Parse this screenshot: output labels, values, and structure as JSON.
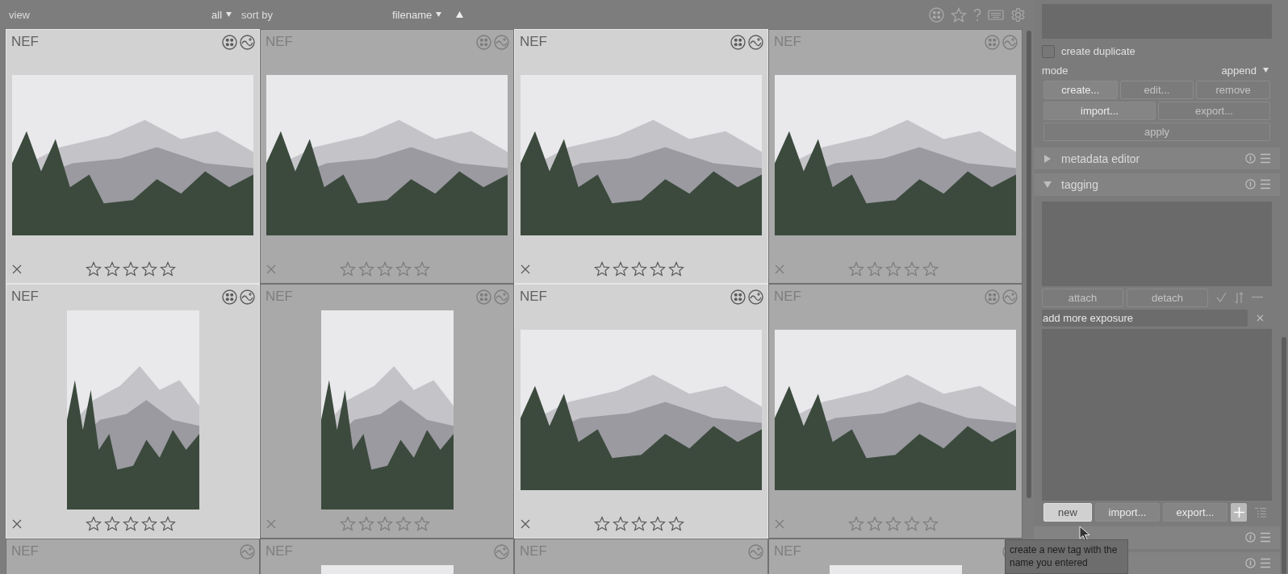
{
  "toolbar": {
    "view_label": "view",
    "view_value": "all",
    "sort_label": "sort by",
    "sort_value": "filename",
    "sort_ascending": true
  },
  "thumbnails": [
    {
      "format": "NEF",
      "selected": true,
      "grouped": true,
      "kind": "landscape",
      "stars": 0
    },
    {
      "format": "NEF",
      "selected": false,
      "grouped": true,
      "kind": "landscape",
      "stars": 0
    },
    {
      "format": "NEF",
      "selected": true,
      "grouped": true,
      "kind": "landscape",
      "stars": 0
    },
    {
      "format": "NEF",
      "selected": false,
      "grouped": true,
      "kind": "landscape",
      "stars": 0
    },
    {
      "format": "NEF",
      "selected": true,
      "grouped": true,
      "kind": "portrait",
      "stars": 0
    },
    {
      "format": "NEF",
      "selected": false,
      "grouped": true,
      "kind": "portrait",
      "stars": 0
    },
    {
      "format": "NEF",
      "selected": true,
      "grouped": true,
      "kind": "landscape",
      "stars": 0
    },
    {
      "format": "NEF",
      "selected": false,
      "grouped": true,
      "kind": "landscape",
      "stars": 0
    },
    {
      "format": "NEF",
      "selected": false,
      "grouped": false,
      "kind": "blank"
    },
    {
      "format": "NEF",
      "selected": false,
      "grouped": false,
      "kind": "portrait"
    },
    {
      "format": "NEF",
      "selected": false,
      "grouped": false,
      "kind": "blank"
    },
    {
      "format": "NEF",
      "selected": false,
      "grouped": false,
      "kind": "portrait"
    }
  ],
  "right_panel": {
    "duplicate": {
      "label": "create duplicate",
      "checked": false
    },
    "mode": {
      "label": "mode",
      "value": "append"
    },
    "style_buttons": [
      [
        {
          "label": "create...",
          "disabled": false
        },
        {
          "label": "edit...",
          "disabled": true
        },
        {
          "label": "remove",
          "disabled": true
        }
      ],
      [
        {
          "label": "import...",
          "disabled": false
        },
        {
          "label": "export...",
          "disabled": true
        }
      ],
      [
        {
          "label": "apply",
          "disabled": true
        }
      ]
    ],
    "sections": [
      {
        "title": "metadata editor",
        "expanded": false
      },
      {
        "title": "tagging",
        "expanded": true
      }
    ],
    "tag_buttons": [
      {
        "label": "attach",
        "disabled": true
      },
      {
        "label": "detach",
        "disabled": true
      }
    ],
    "tag_entry": {
      "value": "add more exposure"
    },
    "dictionary_buttons": [
      {
        "label": "new",
        "hovered": true
      },
      {
        "label": "import...",
        "hovered": false
      },
      {
        "label": "export...",
        "hovered": false
      }
    ],
    "tooltip": "create a new tag with the name you entered"
  }
}
